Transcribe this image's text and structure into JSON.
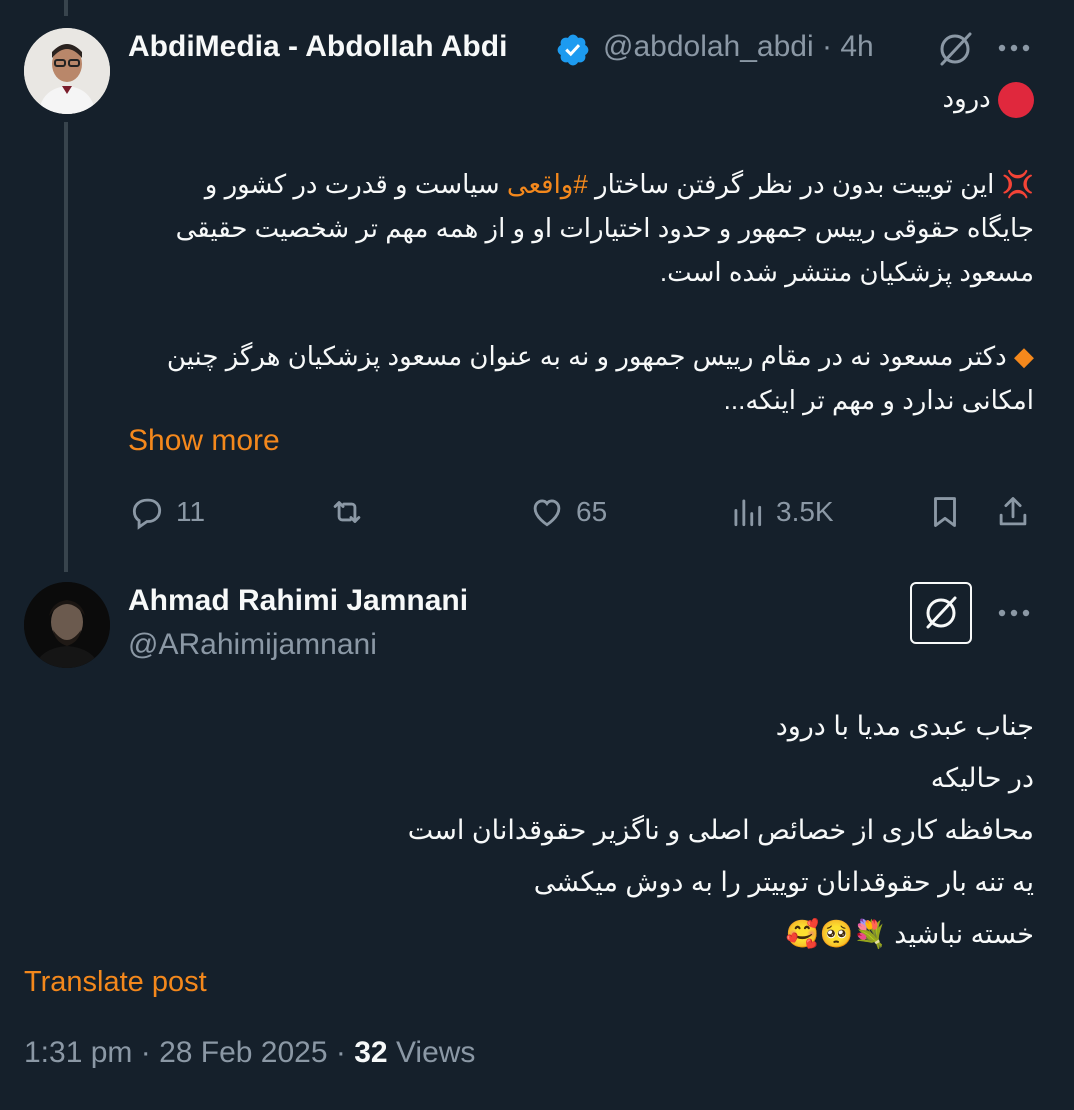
{
  "post1": {
    "display_name": "AbdiMedia - Abdollah Abdi",
    "handle": "@abdolah_abdi",
    "separator": "·",
    "time": "4h",
    "greeting": "درود",
    "para1_prefix": "این توییت بدون در نظر گرفتن ساختار ",
    "para1_hashtag": "#واقعی",
    "para1_suffix": " سیاست و قدرت در کشور و جایگاه حقوقی رییس جمهور و حدود اختیارات او و از همه مهم تر شخصیت حقیقی مسعود پزشکیان منتشر شده است.",
    "para2": "دکتر مسعود نه در مقام رییس جمهور و نه به عنوان مسعود پزشکیان هرگز چنین امکانی ندارد و مهم تر اینکه...",
    "show_more": "Show more",
    "stats": {
      "replies": "11",
      "likes": "65",
      "views": "3.5K"
    }
  },
  "post2": {
    "display_name": "Ahmad Rahimi Jamnani",
    "handle": "@ARahimijamnani",
    "lines": [
      "جناب عبدی مدیا با درود",
      "در حالیکه",
      "محافظه کاری  از خصائص اصلی و ناگزیر حقوقدانان است",
      "یه تنه بار  حقوقدانان توییتر را به دوش میکشی",
      "خسته نباشید"
    ],
    "emojis": "💐🥺🥰",
    "translate": "Translate post",
    "time": "1:31 pm",
    "date": "28 Feb 2025",
    "views_count": "32",
    "views_label": "Views"
  },
  "colors": {
    "background": "#15202b",
    "accent": "#f4881c",
    "muted": "#8b98a5",
    "verified": "#1d9bf0"
  }
}
